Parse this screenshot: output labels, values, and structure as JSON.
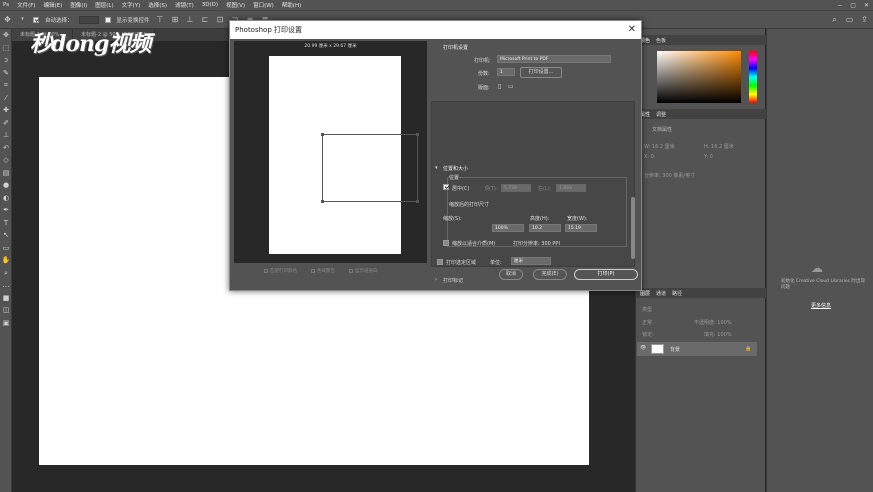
{
  "menu": [
    "文件(F)",
    "编辑(E)",
    "图像(I)",
    "图层(L)",
    "文字(Y)",
    "选择(S)",
    "滤镜(T)",
    "3D(D)",
    "视图(V)",
    "窗口(W)",
    "帮助(H)"
  ],
  "window_controls": [
    "−",
    "▢",
    "✕"
  ],
  "options": {
    "auto_select": "自动选择：",
    "auto_select_value": "图层",
    "show_transform": "显示变换控件"
  },
  "doc_tabs": [
    "未标题-1 @ 50%...",
    "未标题-2 @ 50% (RGB/8#)"
  ],
  "watermark": "秒dong视频",
  "dialog": {
    "title": "Photoshop 打印设置",
    "close": "✕",
    "paper_size": "20.99 厘米 x 29.67 厘米",
    "printer_section": "打印机设置",
    "printer_label": "打印机:",
    "printer_value": "Microsoft Print to PDF",
    "copies_label": "份数:",
    "copies_value": "1",
    "print_settings_btn": "打印设置...",
    "layout_label": "版面:",
    "position_size": "位置和大小",
    "position": "位置",
    "center_label": "居中(C)",
    "top_label": "顶(T):",
    "top_value": "5.739",
    "left_label": "左(L):",
    "left_value": "1.893",
    "scaled_size": "缩放后的打印尺寸",
    "scale_label": "缩放(S):",
    "scale_value": "100%",
    "height_label": "高度(H):",
    "height_value": "10.2",
    "width_label": "宽度(W):",
    "width_value": "15.19",
    "scale_fit": "缩放以适合介质(M)",
    "resolution": "打印分辨率: 300 PPI",
    "print_selection": "打印选定区域",
    "unit_label": "单位:",
    "unit_value": "厘米",
    "print_marks": "打印标记",
    "cancel_btn": "取消",
    "done_btn": "完成(E)",
    "print_btn": "打印(P)",
    "preview_opts": [
      "匹配打印颜色",
      "色域警告",
      "显示纸张白"
    ]
  },
  "right_panel": {
    "color_tabs": [
      "颜色",
      "色板"
    ],
    "props_tabs": [
      "属性",
      "调整"
    ],
    "props_title": "文档属性",
    "w_label": "W: 16.2 厘米",
    "h_label": "H: 16.2 厘米",
    "x_label": "X: 0",
    "y_label": "Y: 0",
    "resolution": "分辨率: 300 像素/英寸",
    "layer_tabs": [
      "图层",
      "通道",
      "路径"
    ],
    "kind": "类型",
    "mode": "正常",
    "opacity": "不透明度: 100%",
    "lock": "锁定:",
    "fill": "填充: 100%",
    "layer_name": "背景"
  },
  "far_right": {
    "libs_msg": "初始化 Creative Cloud Libraries 时出现问题",
    "more_info": "更多信息"
  }
}
